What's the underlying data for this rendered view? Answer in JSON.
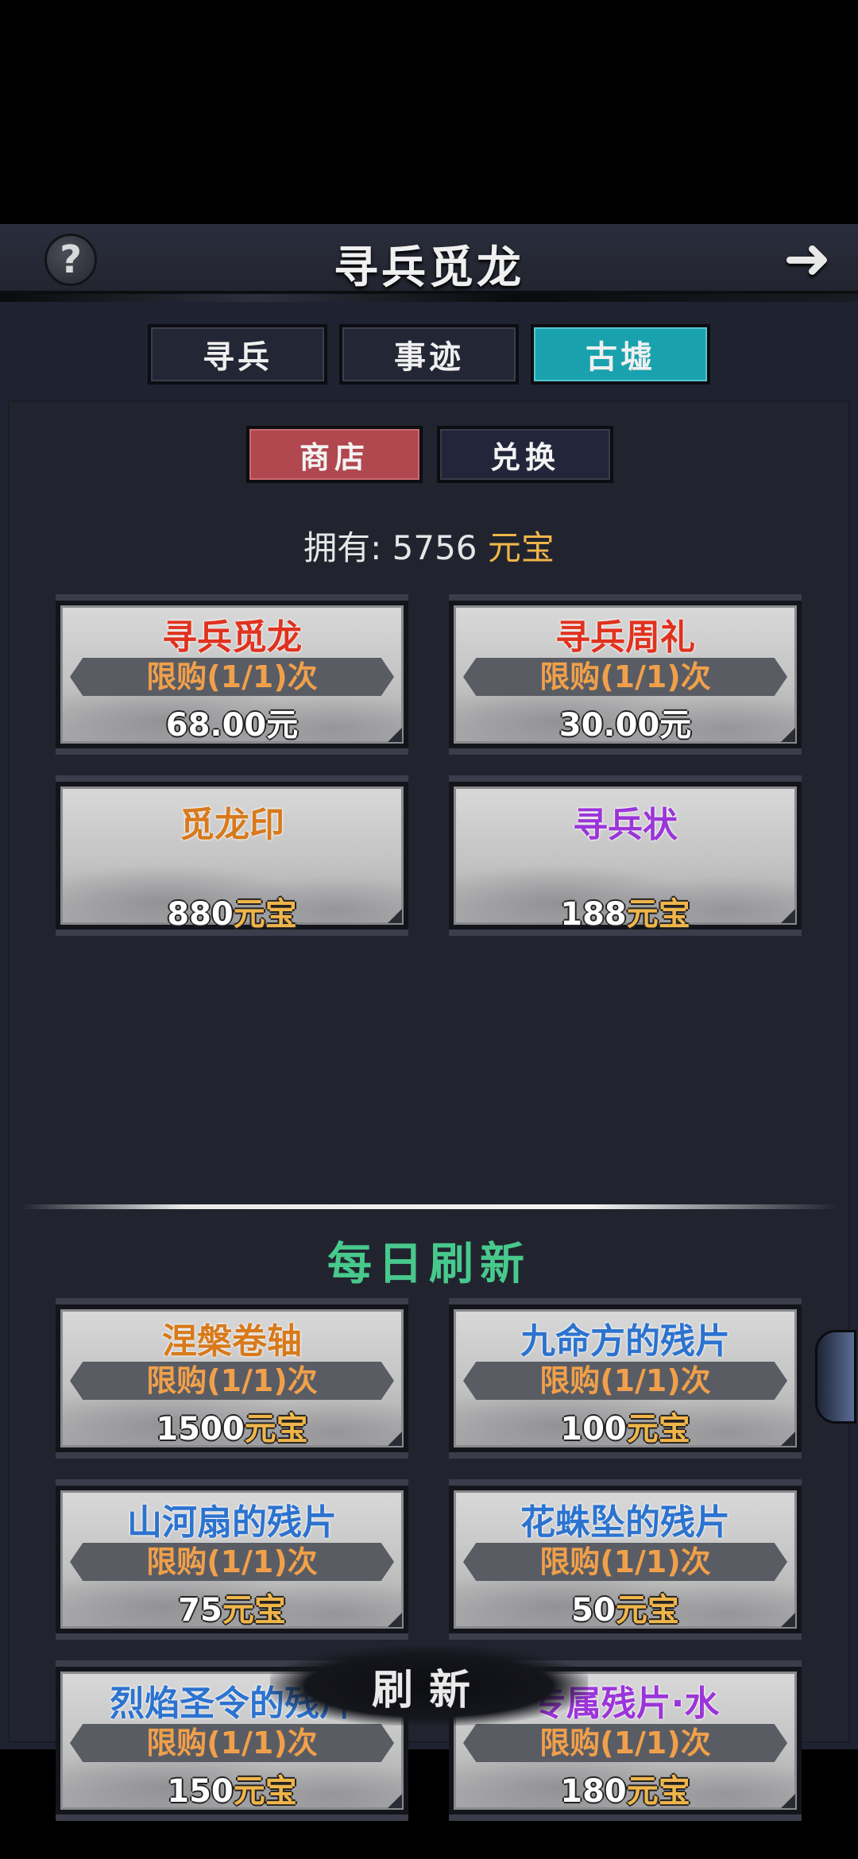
{
  "header": {
    "title": "寻兵觅龙",
    "help_icon": "question-icon",
    "back_icon": "arrow-right-icon",
    "help_glyph": "?",
    "back_glyph": "➜"
  },
  "tabs": [
    {
      "label": "寻兵",
      "active": false
    },
    {
      "label": "事迹",
      "active": false
    },
    {
      "label": "古墟",
      "active": true
    }
  ],
  "subtabs": [
    {
      "label": "商店",
      "active": true
    },
    {
      "label": "兑换",
      "active": false
    }
  ],
  "owned": {
    "label": "拥有:",
    "amount": "5756",
    "currency": "元宝"
  },
  "shop_items": [
    {
      "name": "寻兵觅龙",
      "limit": "限购(1/1)次",
      "price": "68.00元",
      "price_currency": ""
    },
    {
      "name": "寻兵周礼",
      "limit": "限购(1/1)次",
      "price": "30.00元",
      "price_currency": ""
    },
    {
      "name": "觅龙印",
      "limit": "",
      "price": "880",
      "price_currency": "元宝"
    },
    {
      "name": "寻兵状",
      "limit": "",
      "price": "188",
      "price_currency": "元宝"
    }
  ],
  "daily": {
    "title": "每日刷新",
    "items": [
      {
        "name": "涅槃卷轴",
        "limit": "限购(1/1)次",
        "price": "1500",
        "price_currency": "元宝"
      },
      {
        "name": "九命方的残片",
        "limit": "限购(1/1)次",
        "price": "100",
        "price_currency": "元宝"
      },
      {
        "name": "山河扇的残片",
        "limit": "限购(1/1)次",
        "price": "75",
        "price_currency": "元宝"
      },
      {
        "name": "花蛛坠的残片",
        "limit": "限购(1/1)次",
        "price": "50",
        "price_currency": "元宝"
      },
      {
        "name": "烈焰圣令的残片",
        "limit": "限购(1/1)次",
        "price": "150",
        "price_currency": "元宝"
      },
      {
        "name": "专属残片·水",
        "limit": "限购(1/1)次",
        "price": "180",
        "price_currency": "元宝"
      }
    ]
  },
  "refresh_label": "刷新",
  "colors": {
    "tab_active": "#1aa1ae",
    "subtab_active": "#b1474f",
    "currency": "#f0b54a",
    "limit_text": "#f0a04a",
    "daily_title": "#48c98c"
  }
}
